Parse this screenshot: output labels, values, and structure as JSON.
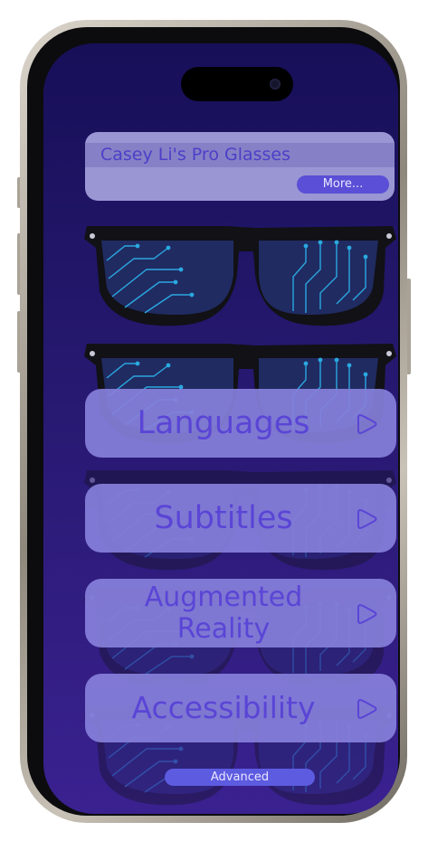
{
  "header": {
    "title": "Casey Li's Pro Glasses",
    "more_label": "More..."
  },
  "menu": {
    "items": [
      {
        "label": "Languages",
        "icon": "play-icon"
      },
      {
        "label": "Subtitles",
        "icon": "play-icon"
      },
      {
        "label": "Augmented Reality",
        "icon": "play-icon"
      },
      {
        "label": "Accessibility",
        "icon": "play-icon"
      }
    ]
  },
  "footer": {
    "advanced_label": "Advanced"
  },
  "colors": {
    "screen_top": "#170f58",
    "screen_bottom": "#3a2190",
    "card": "#8780db",
    "card_text": "#5a45d6",
    "button": "#5a4fd6",
    "circuit": "#2aa8e0"
  },
  "icons": [
    "glasses-illustration",
    "play-icon"
  ]
}
